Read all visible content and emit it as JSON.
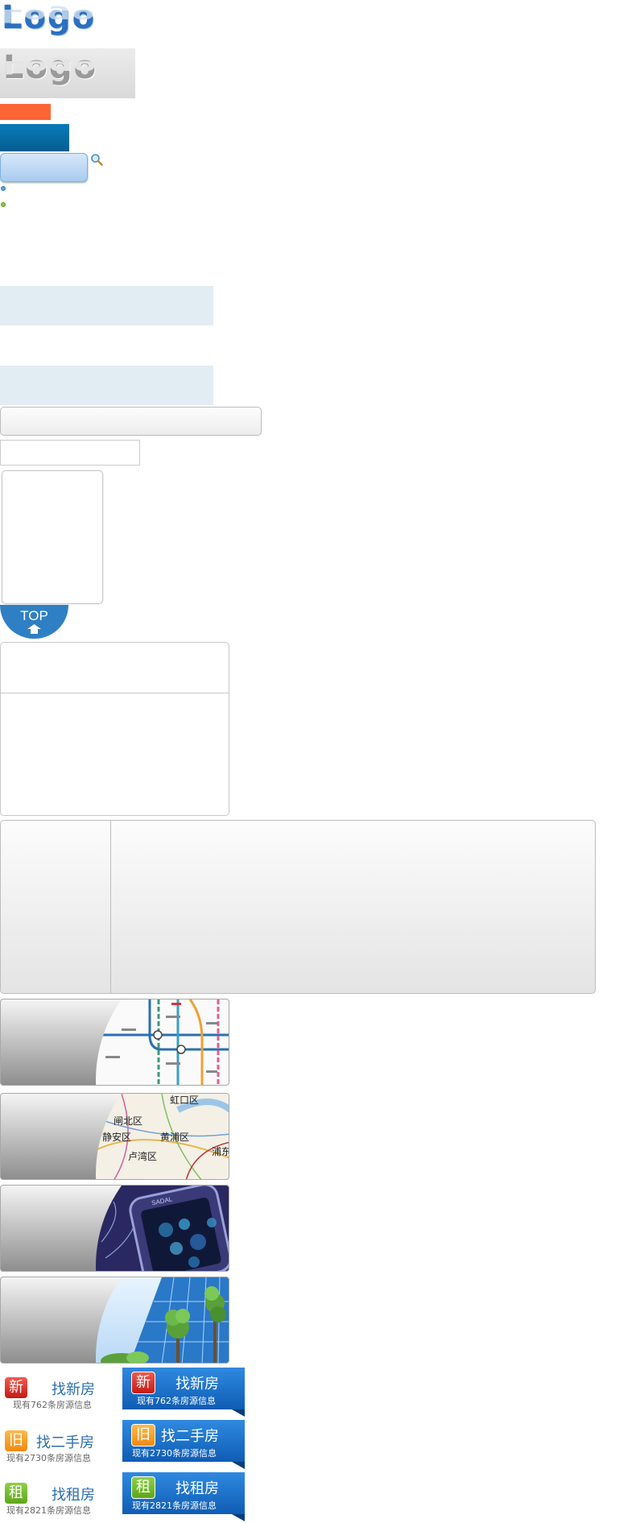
{
  "logo": {
    "text": "Logo"
  },
  "logo_alt": {
    "text": "Logo"
  },
  "top_button": {
    "label": "TOP"
  },
  "tiles": [
    {
      "name": "subway-map"
    },
    {
      "name": "district-map",
      "labels": [
        "虹口区",
        "闸北区",
        "静安区",
        "黄浦区",
        "卢湾区",
        "浦东"
      ]
    },
    {
      "name": "mobile-phone",
      "brand": "SADAL"
    },
    {
      "name": "building-trees"
    }
  ],
  "categories": [
    {
      "badge": "新",
      "badge_color": "#d62a22",
      "title": "找新房",
      "subtitle": "现有762条房源信息"
    },
    {
      "badge": "旧",
      "badge_color": "#f39a1c",
      "title": "找二手房",
      "subtitle": "现有2730条房源信息"
    },
    {
      "badge": "租",
      "badge_color": "#6eb526",
      "title": "找租房",
      "subtitle": "现有2821条房源信息"
    }
  ],
  "colors": {
    "accent_orange": "#ff6433",
    "accent_blue": "#0a6fa8",
    "top_blue": "#2f7fc4"
  }
}
